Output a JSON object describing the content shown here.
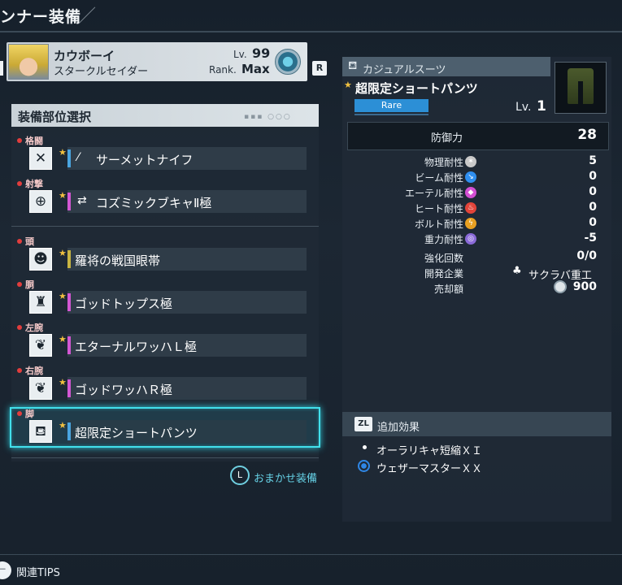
{
  "header": {
    "title": "ンナー装備"
  },
  "character": {
    "name": "カウボーイ",
    "class": "スタークルセイダー",
    "level_label": "Lv.",
    "level": "99",
    "rank_label": "Rank.",
    "rank": "Max",
    "r_button": "R"
  },
  "equip_panel": {
    "title": "装備部位選択",
    "slots": [
      {
        "category": "格闘",
        "icon": "crossed-blades-icon",
        "name": "サーメットナイフ",
        "weapon_icon": "knife-icon",
        "stripe": "#4aa5e0",
        "selected": false
      },
      {
        "category": "射撃",
        "icon": "crosshair-icon",
        "name": "コズミックブキャⅡ極",
        "weapon_icon": "gun-icon",
        "stripe": "#d357d3",
        "selected": false
      },
      {
        "category": "頭",
        "icon": "head-icon",
        "name": "羅将の戦国眼帯",
        "weapon_icon": "",
        "stripe": "#c8b542",
        "selected": false
      },
      {
        "category": "胴",
        "icon": "torso-icon",
        "name": "ゴッドトップス極",
        "weapon_icon": "",
        "stripe": "#d357d3",
        "selected": false
      },
      {
        "category": "左腕",
        "icon": "left-arm-icon",
        "name": "エターナルワッハＬ極",
        "weapon_icon": "",
        "stripe": "#d357d3",
        "selected": false
      },
      {
        "category": "右腕",
        "icon": "right-arm-icon",
        "name": "ゴッドワッハＲ極",
        "weapon_icon": "",
        "stripe": "#d357d3",
        "selected": false
      },
      {
        "category": "脚",
        "icon": "legs-icon",
        "name": "超限定ショートパンツ",
        "weapon_icon": "",
        "stripe": "#4aa5e0",
        "selected": true
      }
    ],
    "auto_equip_button": "L",
    "auto_equip_label": "おまかせ装備"
  },
  "item_detail": {
    "type": "カジュアルスーツ",
    "name": "超限定ショートパンツ",
    "rarity": "Rare",
    "level_label": "Lv.",
    "level": "1",
    "defense_label": "防御力",
    "defense_value": "28",
    "resistances": [
      {
        "label": "物理耐性",
        "value": "5",
        "icon_color": "#c9c9c9",
        "icon": "physical-icon"
      },
      {
        "label": "ビーム耐性",
        "value": "0",
        "icon_color": "#2f8ff0",
        "icon": "beam-icon"
      },
      {
        "label": "エーテル耐性",
        "value": "0",
        "icon_color": "#d34fd3",
        "icon": "ether-icon"
      },
      {
        "label": "ヒート耐性",
        "value": "0",
        "icon_color": "#e2443a",
        "icon": "heat-icon"
      },
      {
        "label": "ボルト耐性",
        "value": "0",
        "icon_color": "#e8a022",
        "icon": "bolt-icon"
      },
      {
        "label": "重力耐性",
        "value": "-5",
        "icon_color": "#8a6ad8",
        "icon": "gravity-icon"
      }
    ],
    "enhance_label": "強化回数",
    "enhance_value": "0/0",
    "maker_label": "開発企業",
    "maker_value": "サクラバ重工",
    "price_label": "売却額",
    "price_value": "900"
  },
  "additional_effects": {
    "button": "ZL",
    "title": "追加効果",
    "effects": [
      "オーラリキャ短縮ＸＩ",
      "ウェザーマスターＸＸ"
    ]
  },
  "footer": {
    "tips_label": "関連TIPS"
  }
}
